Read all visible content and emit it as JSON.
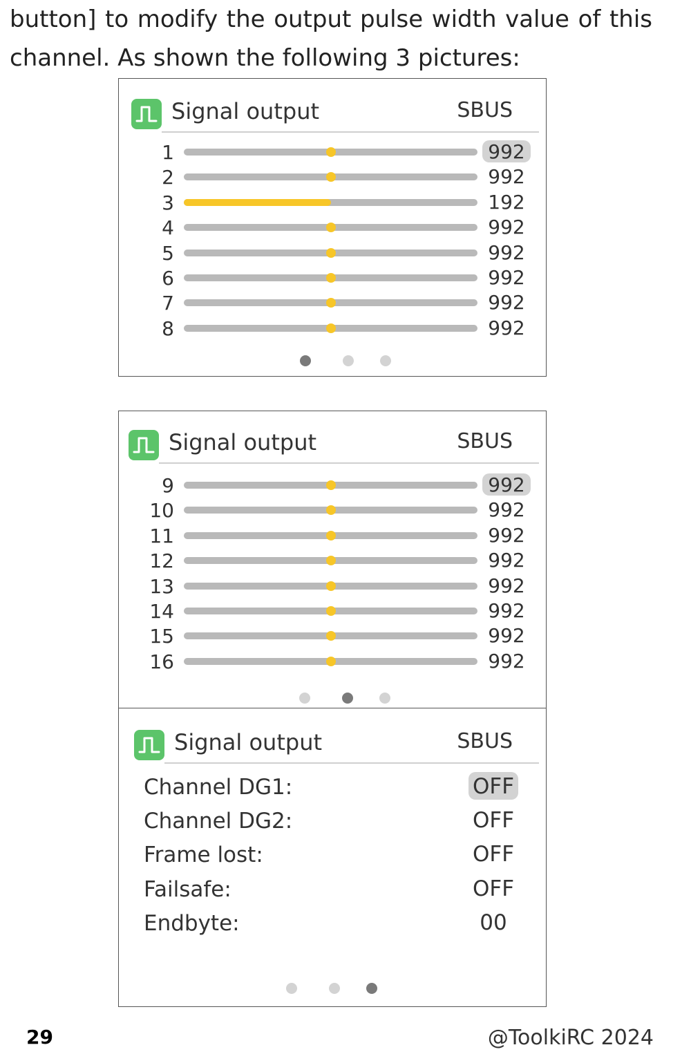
{
  "intro": {
    "line1": "button] to modify the output pulse width value of this",
    "line2": "channel. As shown the following 3 pictures:"
  },
  "panels": [
    {
      "title": "Signal output",
      "protocol": "SBUS",
      "icon": "pulse-wave-icon",
      "channels": [
        {
          "label": "1",
          "value": "992",
          "level": 0.5,
          "selected": true
        },
        {
          "label": "2",
          "value": "992",
          "level": 0.5,
          "selected": false
        },
        {
          "label": "3",
          "value": "192",
          "level": 0.0,
          "selected": false
        },
        {
          "label": "4",
          "value": "992",
          "level": 0.5,
          "selected": false
        },
        {
          "label": "5",
          "value": "992",
          "level": 0.5,
          "selected": false
        },
        {
          "label": "6",
          "value": "992",
          "level": 0.5,
          "selected": false
        },
        {
          "label": "7",
          "value": "992",
          "level": 0.5,
          "selected": false
        },
        {
          "label": "8",
          "value": "992",
          "level": 0.5,
          "selected": false
        }
      ],
      "page_index": 0,
      "page_count": 3
    },
    {
      "title": "Signal output",
      "protocol": "SBUS",
      "icon": "pulse-wave-icon",
      "channels": [
        {
          "label": "9",
          "value": "992",
          "level": 0.5,
          "selected": true
        },
        {
          "label": "10",
          "value": "992",
          "level": 0.5,
          "selected": false
        },
        {
          "label": "11",
          "value": "992",
          "level": 0.5,
          "selected": false
        },
        {
          "label": "12",
          "value": "992",
          "level": 0.5,
          "selected": false
        },
        {
          "label": "13",
          "value": "992",
          "level": 0.5,
          "selected": false
        },
        {
          "label": "14",
          "value": "992",
          "level": 0.5,
          "selected": false
        },
        {
          "label": "15",
          "value": "992",
          "level": 0.5,
          "selected": false
        },
        {
          "label": "16",
          "value": "992",
          "level": 0.5,
          "selected": false
        }
      ],
      "page_index": 1,
      "page_count": 3
    },
    {
      "title": "Signal output",
      "protocol": "SBUS",
      "icon": "pulse-wave-icon",
      "settings": [
        {
          "label": "Channel DG1:",
          "value": "OFF",
          "selected": true
        },
        {
          "label": "Channel DG2:",
          "value": "OFF",
          "selected": false
        },
        {
          "label": "Frame lost:",
          "value": "OFF",
          "selected": false
        },
        {
          "label": "Failsafe:",
          "value": "OFF",
          "selected": false
        },
        {
          "label": "Endbyte:",
          "value": "00",
          "selected": false
        }
      ],
      "page_index": 2,
      "page_count": 3
    }
  ],
  "footer": {
    "page_number": "29",
    "copyright": "@ToolkiRC 2024"
  },
  "colors": {
    "accent_yellow": "#f7c628",
    "icon_green": "#5cc46a",
    "track_gray": "#b9b9b9",
    "highlight_gray": "#d3d3d3",
    "pager_active": "#7a7a7a"
  }
}
